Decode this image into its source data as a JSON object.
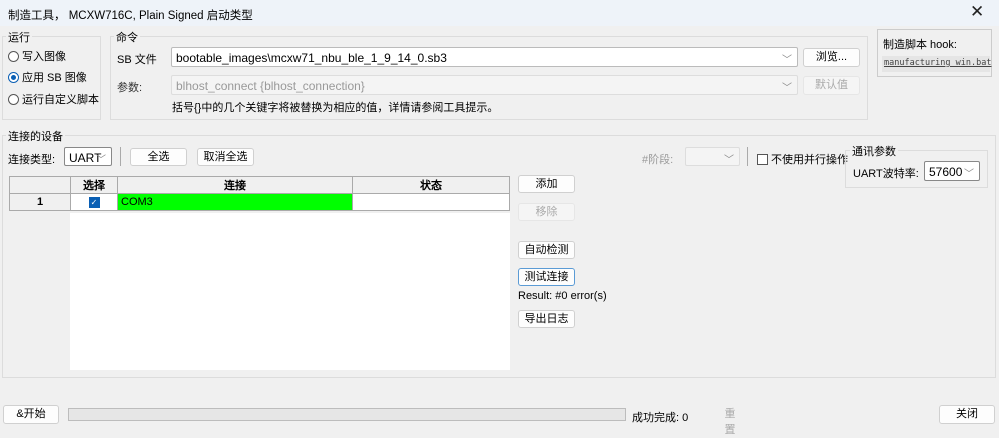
{
  "window": {
    "title": "制造工具， MCXW716C, Plain Signed 启动类型",
    "close_icon": "close-icon"
  },
  "run": {
    "label": "运行",
    "options": [
      "写入图像",
      "应用 SB 图像",
      "运行自定义脚本"
    ],
    "selected": 1
  },
  "command": {
    "label": "命令",
    "sb_file_label": "SB 文件",
    "sb_file_value": "bootable_images\\mcxw71_nbu_ble_1_9_14_0.sb3",
    "browse": "浏览...",
    "params_label": "参数:",
    "params_value": "blhost_connect {blhost_connection}",
    "default": "默认值",
    "hint": "括号{}中的几个关键字将被替换为相应的值，详情请参阅工具提示。"
  },
  "hook": {
    "label": "制造脚本 hook:",
    "value": "manufacturing_win.bat"
  },
  "devices": {
    "label": "连接的设备",
    "conn_type_label": "连接类型:",
    "conn_type": "UART",
    "select_all": "全选",
    "deselect_all": "取消全选",
    "stage_label": "#阶段:",
    "no_parallel": "不使用并行操作",
    "columns": [
      "选择",
      "连接",
      "状态"
    ],
    "rows": [
      {
        "index": "1",
        "checked": true,
        "connection": "COM3",
        "status": ""
      }
    ],
    "add": "添加",
    "remove": "移除",
    "auto_detect": "自动检测",
    "test_conn": "测试连接",
    "result": "Result: #0 error(s)",
    "export_log": "导出日志"
  },
  "comm": {
    "label": "通讯参数",
    "baud_label": "UART波特率:",
    "baud": "57600"
  },
  "footer": {
    "start": "&开始",
    "progress": 0,
    "success_label": "成功完成: 0",
    "reset": "重置",
    "close": "关闭"
  },
  "colors": {
    "ok": "#00ff00",
    "accent": "#0a5fb4"
  }
}
